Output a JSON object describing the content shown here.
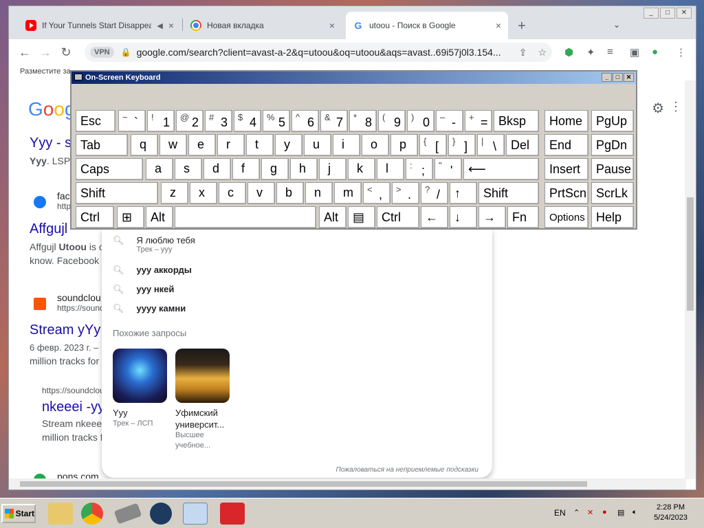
{
  "browser": {
    "tabs": [
      {
        "title": "If Your Tunnels Start Disappear",
        "audio": "◀",
        "close": "×"
      },
      {
        "title": "Новая вкладка",
        "close": "×"
      },
      {
        "title": "utoou - Поиск в Google",
        "close": "×"
      }
    ],
    "new_tab": "+",
    "url": "google.com/search?client=avast-a-2&q=utoou&oq=utoou&aqs=avast..69i57j0l3.154...",
    "vpn_label": "VPN",
    "bookmark_hint": "Разместите за"
  },
  "page": {
    "logo": "Goog",
    "results": [
      {
        "title": "Yyy - s",
        "snippet_bold": "Yyy",
        "snippet": ". LSP"
      },
      {
        "cite": "fac",
        "url": "http",
        "title": "Affgujl",
        "snippet_a": "Affgujl ",
        "snippet_bold": "Utoou",
        "snippet_b": " is c",
        "snippet2": "know. Facebook"
      },
      {
        "cite": "soundclou",
        "url": "https://sound",
        "title": "Stream yYy",
        "snippet": "6 февр. 2023 г. –",
        "snippet2": "million tracks for"
      },
      {
        "url": "https://soundclou",
        "title": "nkeeei -yy",
        "snippet": "Stream nkeee",
        "snippet2": "million tracks f"
      },
      {
        "cite": "pons.com"
      }
    ]
  },
  "suggest": {
    "items": [
      {
        "text": "Я люблю тебя",
        "sub": "Трек – yyy"
      },
      {
        "text": "yyy аккорды"
      },
      {
        "text": "yyy нкей"
      },
      {
        "text": "yyyy камни"
      }
    ],
    "related_heading": "Похожие запросы",
    "cards": [
      {
        "title": "Yyy",
        "sub": "Трек – ЛСП"
      },
      {
        "title": "Уфимский университ...",
        "sub": "Высшее учебное..."
      }
    ],
    "report": "Пожаловаться на неприемлемые подсказки"
  },
  "osk": {
    "title": "On-Screen Keyboard"
  },
  "taskbar": {
    "start": "Start",
    "lang": "EN",
    "time": "2:28 PM",
    "date": "5/24/2023"
  }
}
